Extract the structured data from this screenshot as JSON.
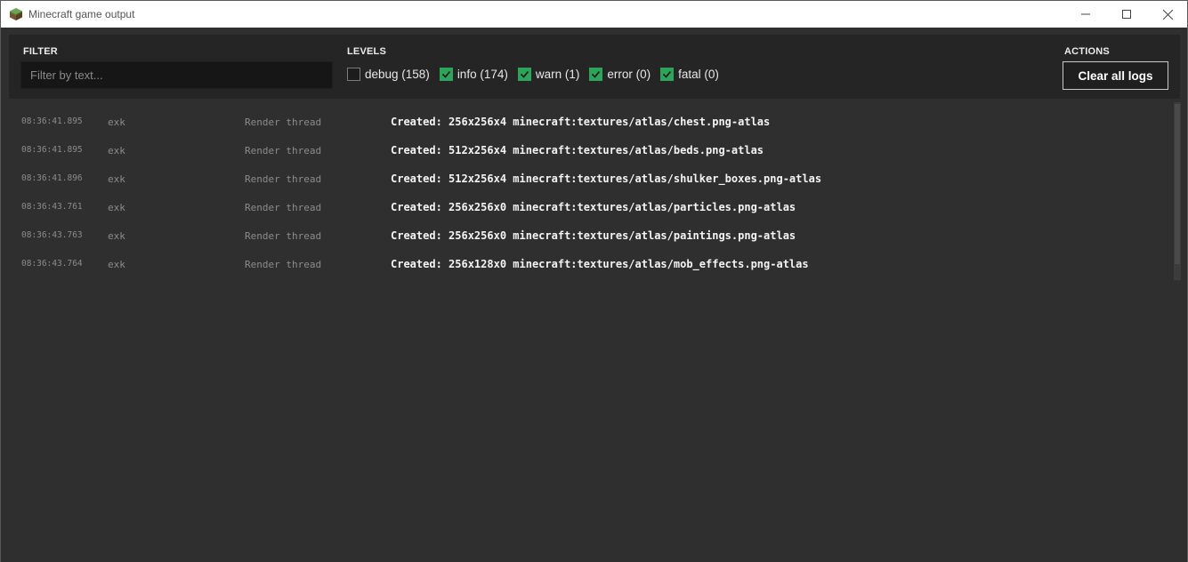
{
  "window": {
    "title": "Minecraft game output",
    "icon": "minecraft-grass-block-icon"
  },
  "filter": {
    "label": "FILTER",
    "placeholder": "Filter by text...",
    "value": ""
  },
  "levels": {
    "label": "LEVELS",
    "items": [
      {
        "label": "debug (158)",
        "checked": false
      },
      {
        "label": "info (174)",
        "checked": true
      },
      {
        "label": "warn (1)",
        "checked": true
      },
      {
        "label": "error (0)",
        "checked": true
      },
      {
        "label": "fatal (0)",
        "checked": true
      }
    ]
  },
  "actions": {
    "label": "ACTIONS",
    "clear_label": "Clear all logs"
  },
  "logs": [
    {
      "time": "08:36:41.895",
      "logger": "exk",
      "thread": "Render thread",
      "message": "Created: 256x256x4 minecraft:textures/atlas/chest.png-atlas"
    },
    {
      "time": "08:36:41.895",
      "logger": "exk",
      "thread": "Render thread",
      "message": "Created: 512x256x4 minecraft:textures/atlas/beds.png-atlas"
    },
    {
      "time": "08:36:41.896",
      "logger": "exk",
      "thread": "Render thread",
      "message": "Created: 512x256x4 minecraft:textures/atlas/shulker_boxes.png-atlas"
    },
    {
      "time": "08:36:43.761",
      "logger": "exk",
      "thread": "Render thread",
      "message": "Created: 256x256x0 minecraft:textures/atlas/particles.png-atlas"
    },
    {
      "time": "08:36:43.763",
      "logger": "exk",
      "thread": "Render thread",
      "message": "Created: 256x256x0 minecraft:textures/atlas/paintings.png-atlas"
    },
    {
      "time": "08:36:43.764",
      "logger": "exk",
      "thread": "Render thread",
      "message": "Created: 256x128x0 minecraft:textures/atlas/mob_effects.png-atlas"
    }
  ],
  "colors": {
    "checkbox_checked": "#2aa55a",
    "background": "#2f2f2f",
    "toolbar": "#252525"
  }
}
